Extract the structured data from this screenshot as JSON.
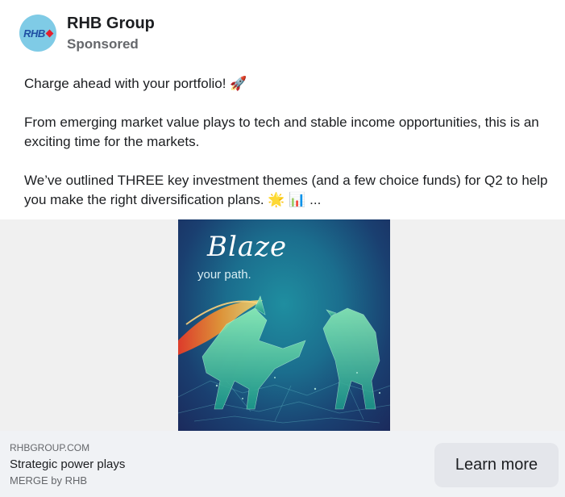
{
  "post": {
    "page_name": "RHB Group",
    "sponsored_label": "Sponsored",
    "avatar_text": "RHB",
    "body": [
      "Charge ahead with your portfolio! 🚀",
      "From emerging market value plays to tech and stable income opportunities, this is an exciting time for the markets.",
      "We’ve outlined THREE key investment themes (and a few choice funds) for Q2 to help you make the right diversification plans. 🌟 📊 ..."
    ]
  },
  "creative": {
    "headline_script": "Blaze",
    "subline": "your path."
  },
  "link": {
    "domain": "RHBGROUP.COM",
    "headline": "Strategic power plays",
    "description": "MERGE by RHB",
    "cta_label": "Learn more"
  },
  "colors": {
    "avatar_bg": "#7fcbe6",
    "brand_blue": "#1f4fa3",
    "brand_red": "#e4202e",
    "footer_bg": "#f0f2f5",
    "cta_bg": "#e4e6eb"
  }
}
